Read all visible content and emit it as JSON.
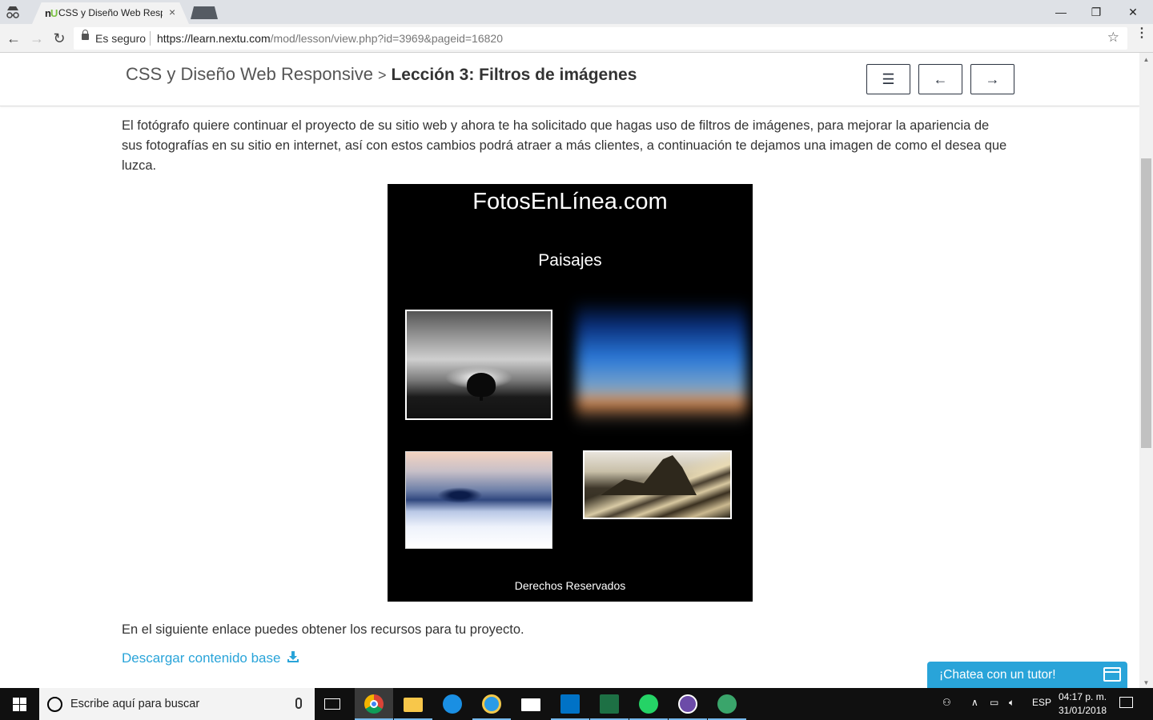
{
  "browser": {
    "tab_title": "CSS y Diseño Web Respo",
    "tab_close": "×",
    "favicon_text_n": "n",
    "favicon_text_u": "U",
    "secure_label": "Es seguro",
    "url_host": "https://learn.nextu.com",
    "url_path": "/mod/lesson/view.php?id=3969&pageid=16820",
    "window_minimize": "—",
    "window_restore": "❐",
    "window_close": "✕"
  },
  "header": {
    "course": "CSS y Diseño Web Responsive",
    "separator": ">",
    "lesson": "Lección 3: Filtros de imágenes",
    "menu_icon": "☰",
    "prev_icon": "←",
    "next_icon": "→"
  },
  "content": {
    "intro": "El fotógrafo quiere continuar el proyecto de su sitio web y ahora te ha solicitado que hagas uso de filtros de imágenes, para mejorar la apariencia de sus fotografías en su sitio en internet, así con estos cambios podrá atraer a más clientes, a continuación te dejamos una imagen de como el desea que luzca.",
    "mockup": {
      "brand": "FotosEnLínea.com",
      "section": "Paisajes",
      "footer": "Derechos Reservados"
    },
    "resources_text": "En el siguiente enlace puedes obtener los recursos para tu proyecto.",
    "download_link": "Descargar contenido base"
  },
  "chat": {
    "label": "¡Chatea con un tutor!"
  },
  "taskbar": {
    "search_placeholder": "Escribe aquí para buscar",
    "language": "ESP",
    "time": "04:17 p. m.",
    "date": "31/01/2018",
    "apps": [
      "chrome-icon",
      "file-explorer-icon",
      "edge-icon",
      "internet-explorer-icon",
      "mail-icon",
      "outlook-icon",
      "excel-icon",
      "whatsapp-icon",
      "gitkraken-icon",
      "app-green-icon"
    ]
  }
}
